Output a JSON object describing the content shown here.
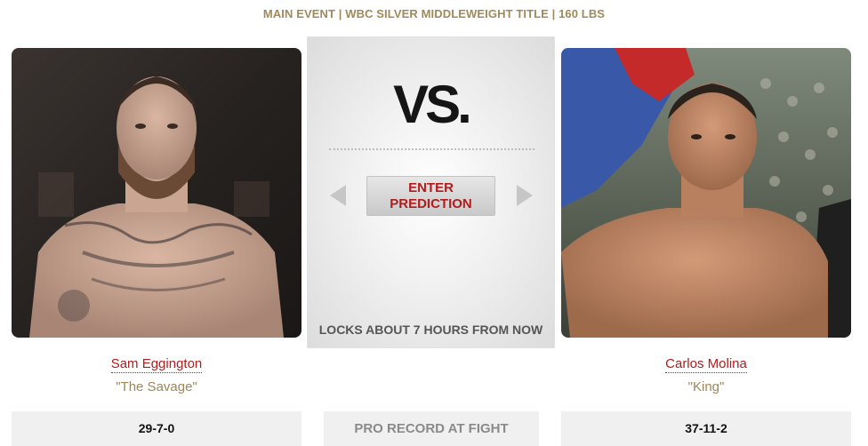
{
  "event": {
    "title": "MAIN EVENT | WBC SILVER MIDDLEWEIGHT TITLE | 160 LBS"
  },
  "center": {
    "vs_text": "VS.",
    "predict_line1": "ENTER",
    "predict_line2": "PREDICTION",
    "locks_text": "LOCKS ABOUT 7 HOURS FROM NOW"
  },
  "fighters": [
    {
      "name": "Sam Eggington",
      "nickname": "\"The Savage\"",
      "record": "29-7-0"
    },
    {
      "name": "Carlos Molina",
      "nickname": "\"King\"",
      "record": "37-11-2"
    }
  ],
  "record_label": "PRO RECORD AT FIGHT",
  "colors": {
    "accent_red": "#b21c1c",
    "gold": "#a08a5a",
    "panel_gray": "#f0f0f0"
  },
  "icons": {
    "prev": "left-arrow-icon",
    "next": "right-arrow-icon"
  }
}
